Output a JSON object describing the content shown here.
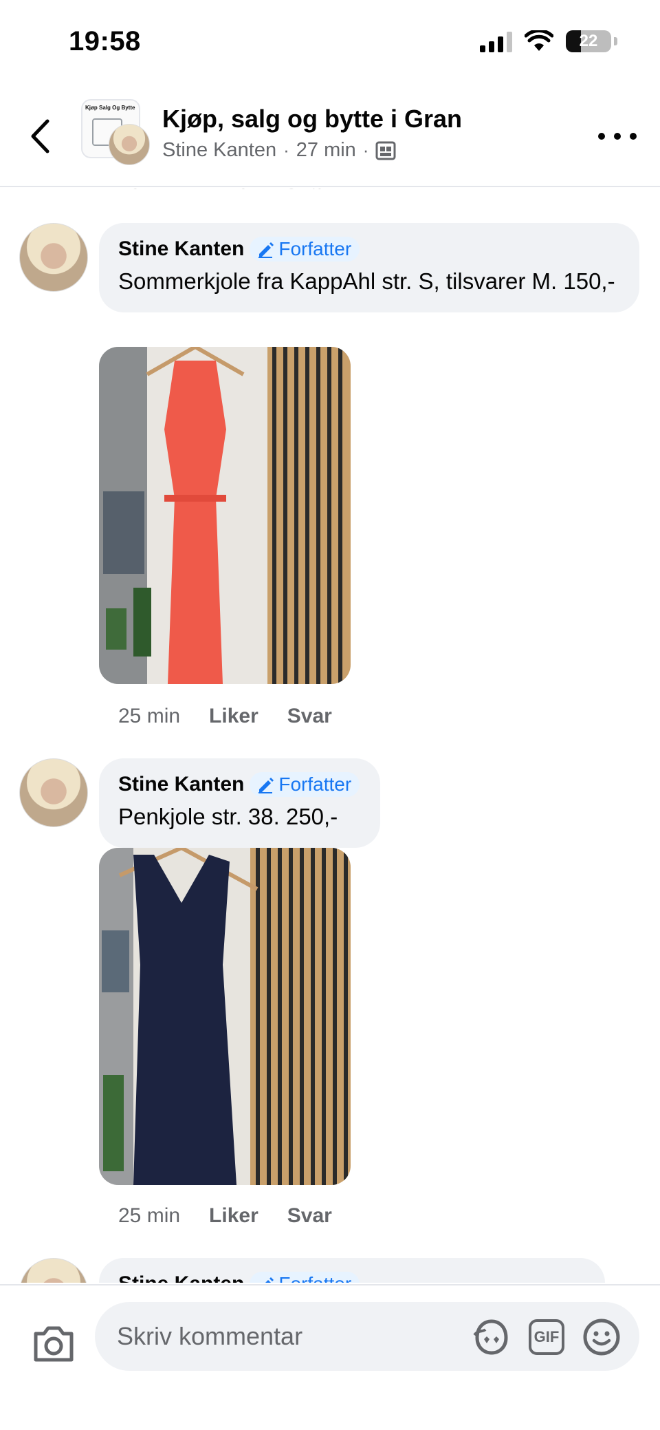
{
  "status": {
    "time": "19:58",
    "battery": "22"
  },
  "header": {
    "title": "Kjøp, salg og bytte i Gran",
    "author": "Stine Kanten",
    "time": "27 min",
    "group_thumb_text": "Kjøp Salg Og Bytte"
  },
  "cut_comment": {
    "time": "25 min",
    "like": "Liker",
    "reply": "Svar"
  },
  "comments": [
    {
      "author": "Stine Kanten",
      "badge": "Forfatter",
      "text": "Sommerkjole fra KappAhl str. S, tilsvarer M. 150,-",
      "time": "25 min",
      "like": "Liker",
      "reply": "Svar",
      "photo_color": "#ef5a4a"
    },
    {
      "author": "Stine Kanten",
      "badge": "Forfatter",
      "text": "Penkjole str. 38. 250,-",
      "time": "25 min",
      "like": "Liker",
      "reply": "Svar",
      "photo_color": "#1c2340"
    },
    {
      "author": "Stine Kanten",
      "badge": "Forfatter"
    }
  ],
  "composer": {
    "placeholder": "Skriv kommentar",
    "gif_label": "GIF"
  },
  "icons": [
    "back-arrow-icon",
    "more-options-icon",
    "photo-album-icon",
    "pencil-icon",
    "camera-icon",
    "avatar-sticker-icon",
    "gif-icon",
    "emoji-icon"
  ],
  "colors": {
    "accent": "#1877f2",
    "bubble": "#f0f2f5",
    "secondary_text": "#65676b"
  }
}
